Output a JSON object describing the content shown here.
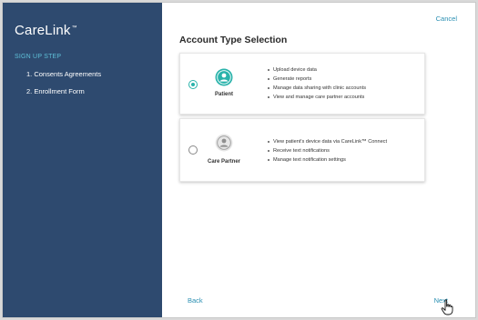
{
  "sidebar": {
    "brand": "CareLink",
    "brand_tm": "™",
    "step_heading": "SIGN UP STEP",
    "steps": [
      {
        "label": "1. Consents Agreements"
      },
      {
        "label": "2. Enrollment Form"
      }
    ]
  },
  "header": {
    "cancel_label": "Cancel",
    "title": "Account Type Selection"
  },
  "options": [
    {
      "label": "Patient",
      "selected": true,
      "features": [
        "Upload device data",
        "Generate reports",
        "Manage data sharing with clinic accounts",
        "View and manage care partner accounts"
      ]
    },
    {
      "label": "Care Partner",
      "selected": false,
      "features": [
        "View patient's device data via CareLink™ Connect",
        "Receive text notifications",
        "Manage text notification settings"
      ]
    }
  ],
  "footer": {
    "back_label": "Back",
    "next_label": "Next"
  },
  "colors": {
    "sidebar_bg": "#2e4a6f",
    "accent_teal": "#2ab3ab",
    "link_blue": "#2a8fb2",
    "step_heading": "#5fc0d8"
  },
  "icons": {
    "patient": "person-icon",
    "care_partner": "person-icon"
  }
}
